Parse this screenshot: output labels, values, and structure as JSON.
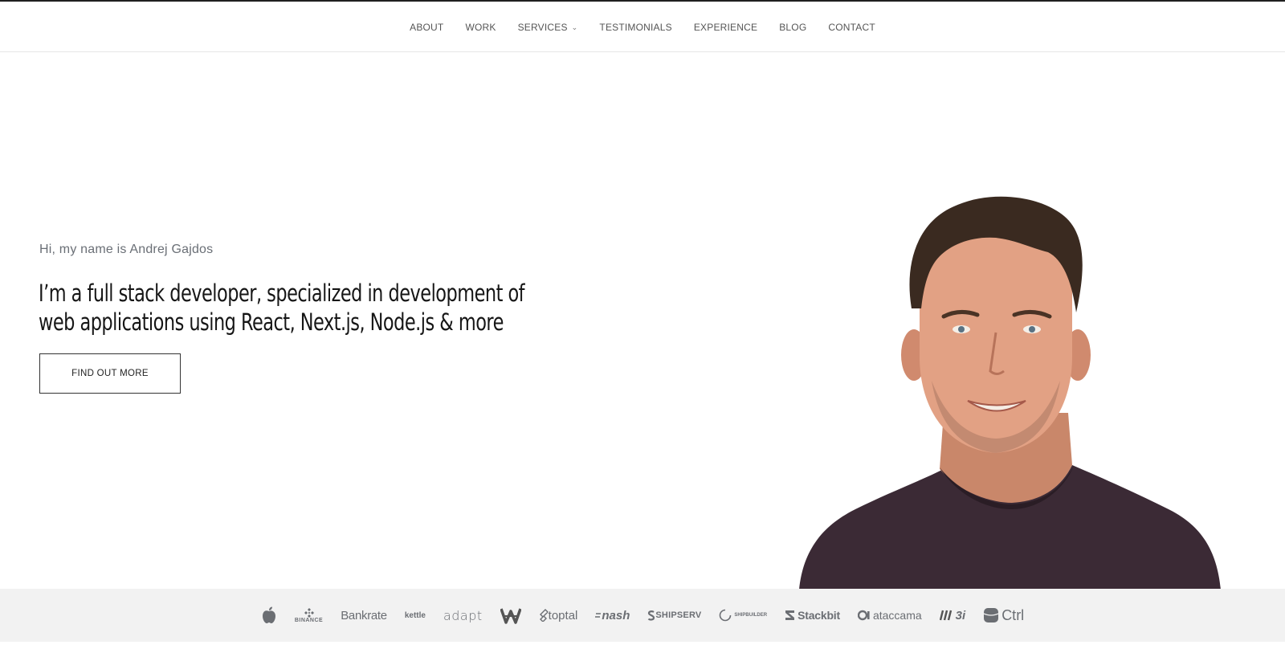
{
  "nav": {
    "items": [
      {
        "label": "ABOUT"
      },
      {
        "label": "WORK"
      },
      {
        "label": "SERVICES",
        "has_dropdown": true
      },
      {
        "label": "TESTIMONIALS"
      },
      {
        "label": "EXPERIENCE"
      },
      {
        "label": "BLOG"
      },
      {
        "label": "CONTACT"
      }
    ]
  },
  "hero": {
    "intro": "Hi, my name is Andrej Gajdos",
    "headline": "I’m a full stack developer, specialized in development of web applications using React, Next.js, Node.js & more",
    "cta_label": "FIND OUT MORE"
  },
  "logos": {
    "items": [
      {
        "name": "apple-logo",
        "text": ""
      },
      {
        "name": "binance-logo",
        "text": "BINANCE"
      },
      {
        "name": "bankrate-logo",
        "text": "Bankrate"
      },
      {
        "name": "kettle-logo",
        "text": "kettle"
      },
      {
        "name": "adapt-logo",
        "text": "adapt"
      },
      {
        "name": "wa-logo",
        "text": ""
      },
      {
        "name": "toptal-logo",
        "text": "toptal"
      },
      {
        "name": "nash-logo",
        "text": "nash"
      },
      {
        "name": "shipserv-logo",
        "text": "SHIPSERV"
      },
      {
        "name": "shipbuilder-logo",
        "text": "SHIPBUILDER"
      },
      {
        "name": "stackbit-logo",
        "text": "Stackbit"
      },
      {
        "name": "ataccama-logo",
        "text": "ataccama"
      },
      {
        "name": "3i-logo",
        "text": "3i"
      },
      {
        "name": "ctrl-logo",
        "text": "Ctrl"
      }
    ]
  },
  "colors": {
    "text_dark": "#161616",
    "text_muted": "#6a6f76",
    "nav_text": "#555555",
    "logo_band": "#f2f2f2",
    "logo_color": "#6b6e73",
    "shirt": "#3b2a35"
  }
}
